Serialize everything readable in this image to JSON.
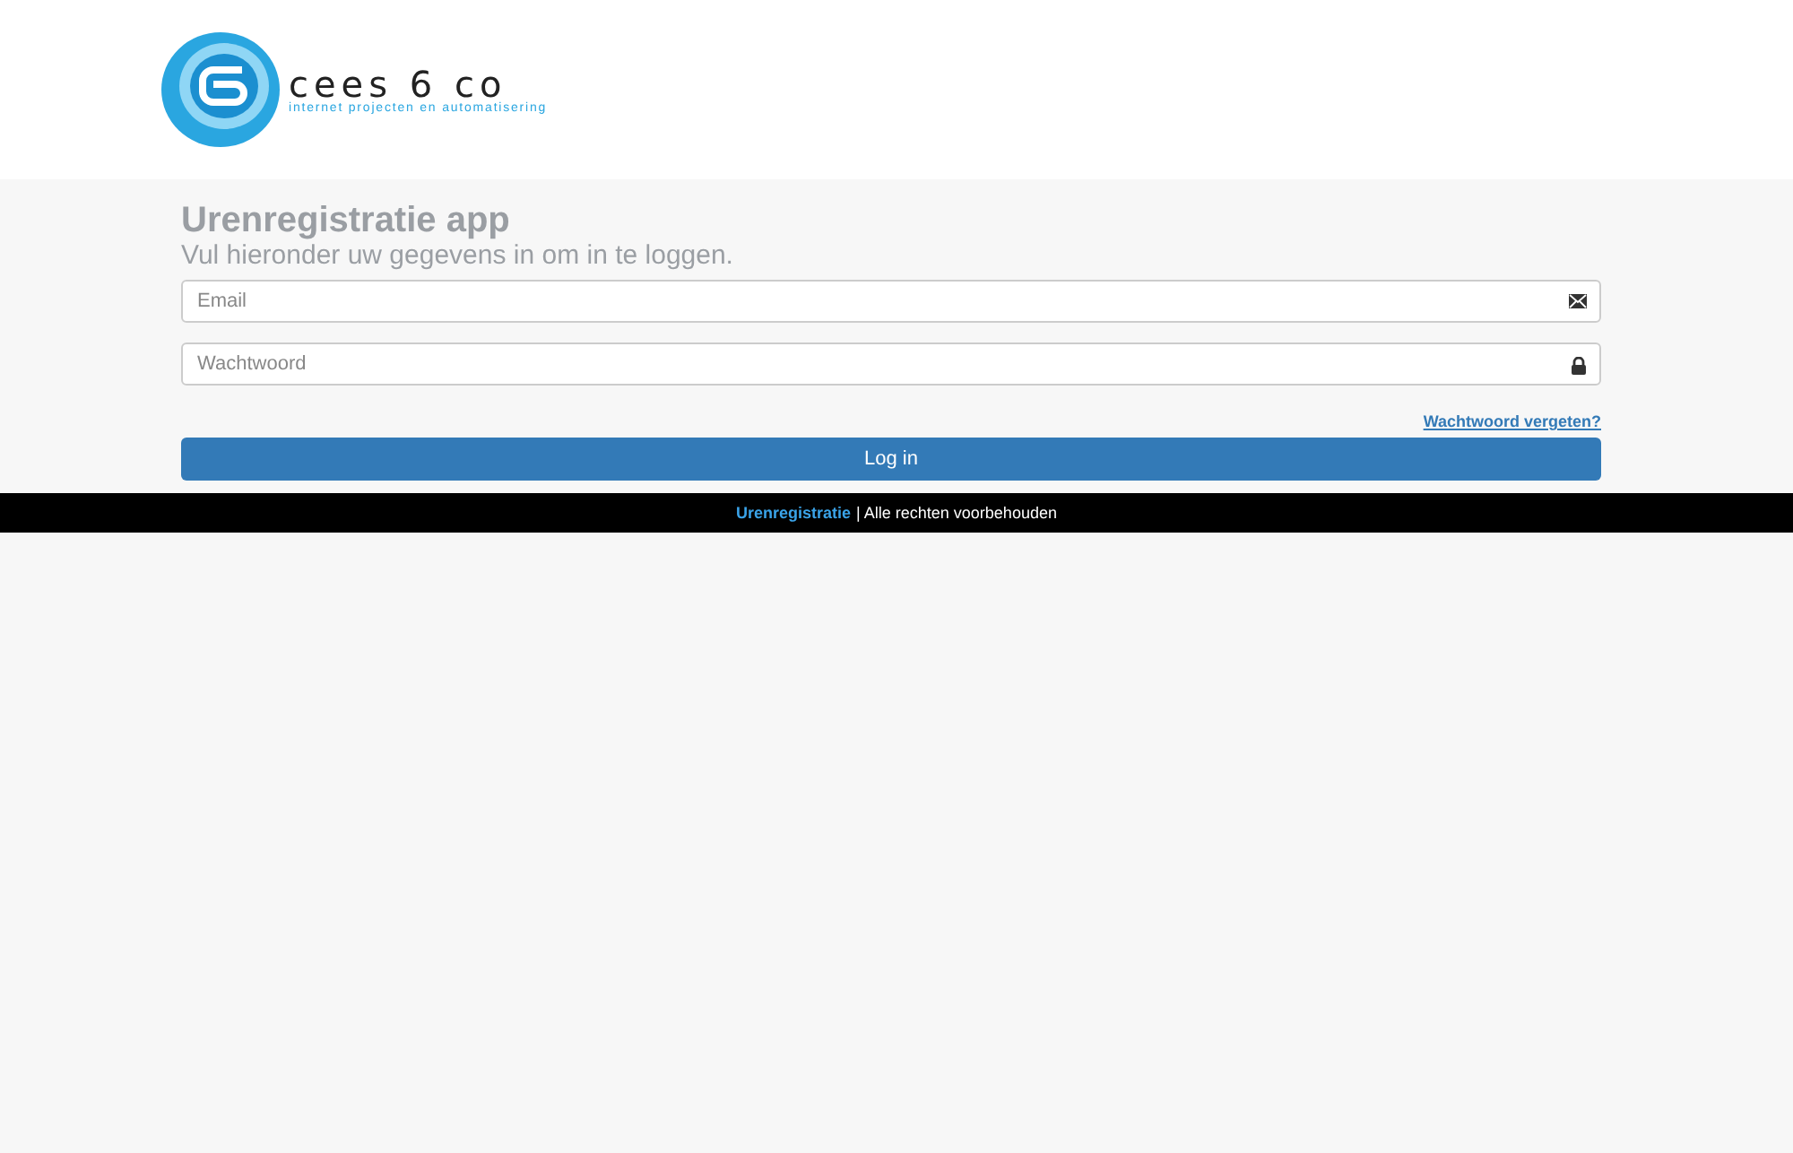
{
  "logo": {
    "name": "cees 6 co",
    "tagline": "internet projecten en automatisering"
  },
  "title": "Urenregistratie app",
  "subtitle": "Vul hieronder uw gegevens in om in te loggen.",
  "fields": [
    {
      "kind": "email",
      "placeholder": "Email"
    },
    {
      "kind": "password",
      "placeholder": "Wachtwoord"
    }
  ],
  "forgot_link": "Wachtwoord vergeten?",
  "login_button": "Log in",
  "footer": {
    "link": "Urenregistratie",
    "text": "| Alle rechten voorbehouden"
  }
}
